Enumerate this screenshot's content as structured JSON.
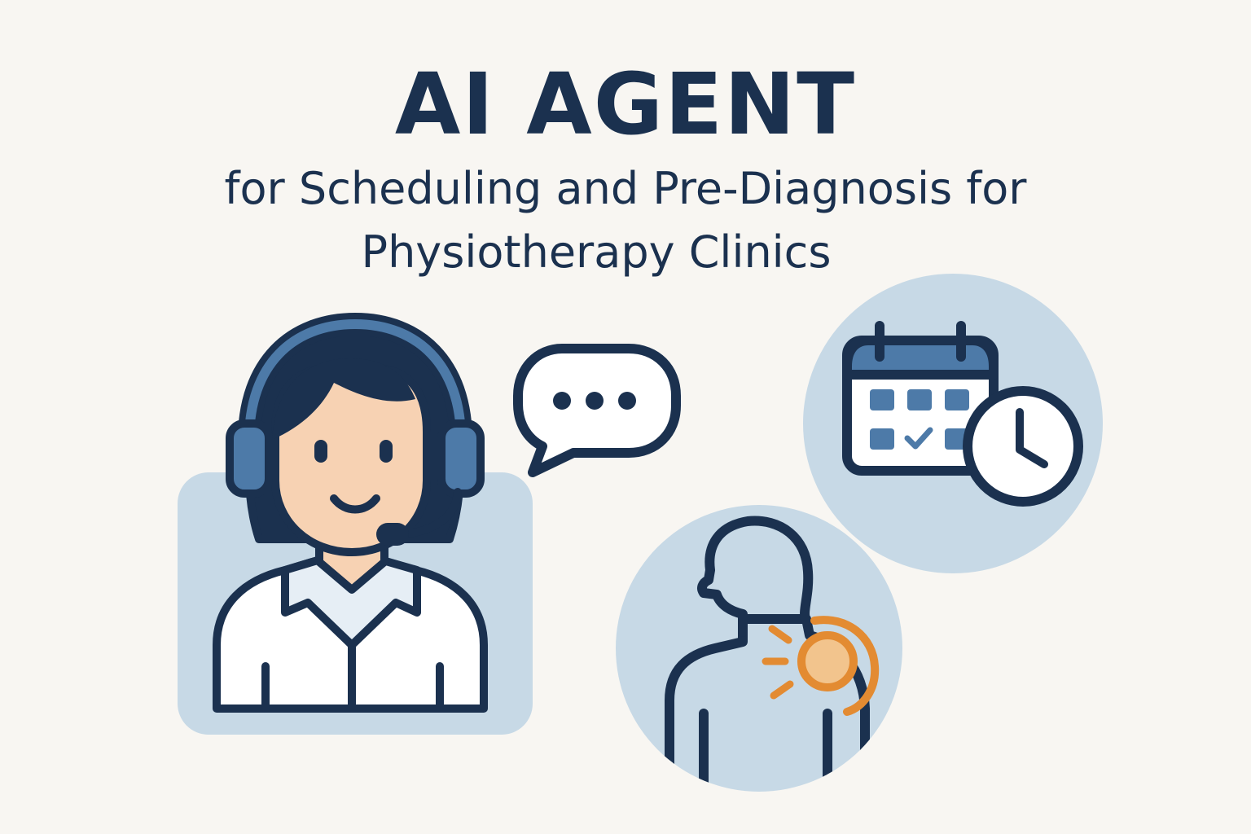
{
  "header": {
    "title": "AI AGENT",
    "subtitle_line1": "for Scheduling and Pre-Diagnosis for",
    "subtitle_line2": "Physiotherapy Clinics"
  },
  "illustrations": {
    "agent": "headset-agent-icon",
    "chat": "speech-bubble-icon",
    "calendar": "calendar-icon",
    "clock": "clock-icon",
    "patient": "shoulder-pain-icon"
  },
  "colors": {
    "background": "#f8f6f2",
    "navy": "#1b314f",
    "mid_blue": "#4d7aa8",
    "light_blue": "#c7d9e6",
    "skin": "#f7d2b3",
    "pain_orange": "#e38b32",
    "pain_fill": "#f2c48d"
  }
}
